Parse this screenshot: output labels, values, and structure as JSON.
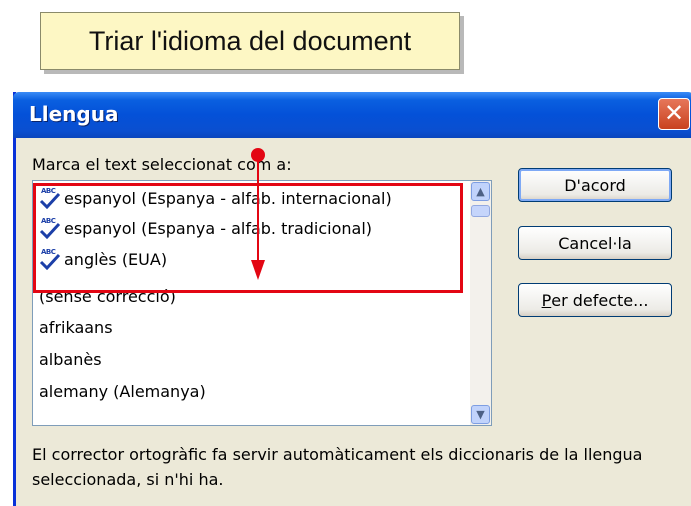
{
  "callout": {
    "text": "Triar l'idioma del document"
  },
  "dialog": {
    "title": "Llengua",
    "close_glyph": "✕",
    "mark_label": "Marca el text seleccionat com a:",
    "list_items": [
      {
        "label": "espanyol (Espanya - alfab. internacional)",
        "spell_icon": true
      },
      {
        "label": "espanyol (Espanya - alfab. tradicional)",
        "spell_icon": true
      },
      {
        "label": "anglès (EUA)",
        "spell_icon": true
      },
      {
        "label": "(sense correcció)",
        "spell_icon": false
      },
      {
        "label": "afrikaans",
        "spell_icon": false
      },
      {
        "label": "albanès",
        "spell_icon": false
      },
      {
        "label": "alemany (Alemanya)",
        "spell_icon": false
      }
    ],
    "spell_icon_text": "ABC",
    "buttons": {
      "ok": "D'acord",
      "cancel": "Cancel·la",
      "default_prefix": "P",
      "default_rest": "er defecte..."
    },
    "description": "El corrector ortogràfic fa servir automàticament els diccionaris de la llengua seleccionada, si n'hi ha."
  },
  "colors": {
    "highlight": "#e30613",
    "titlebar": "#0451d8",
    "callout_bg": "#fdf7c4",
    "window_bg": "#ece9d8"
  }
}
